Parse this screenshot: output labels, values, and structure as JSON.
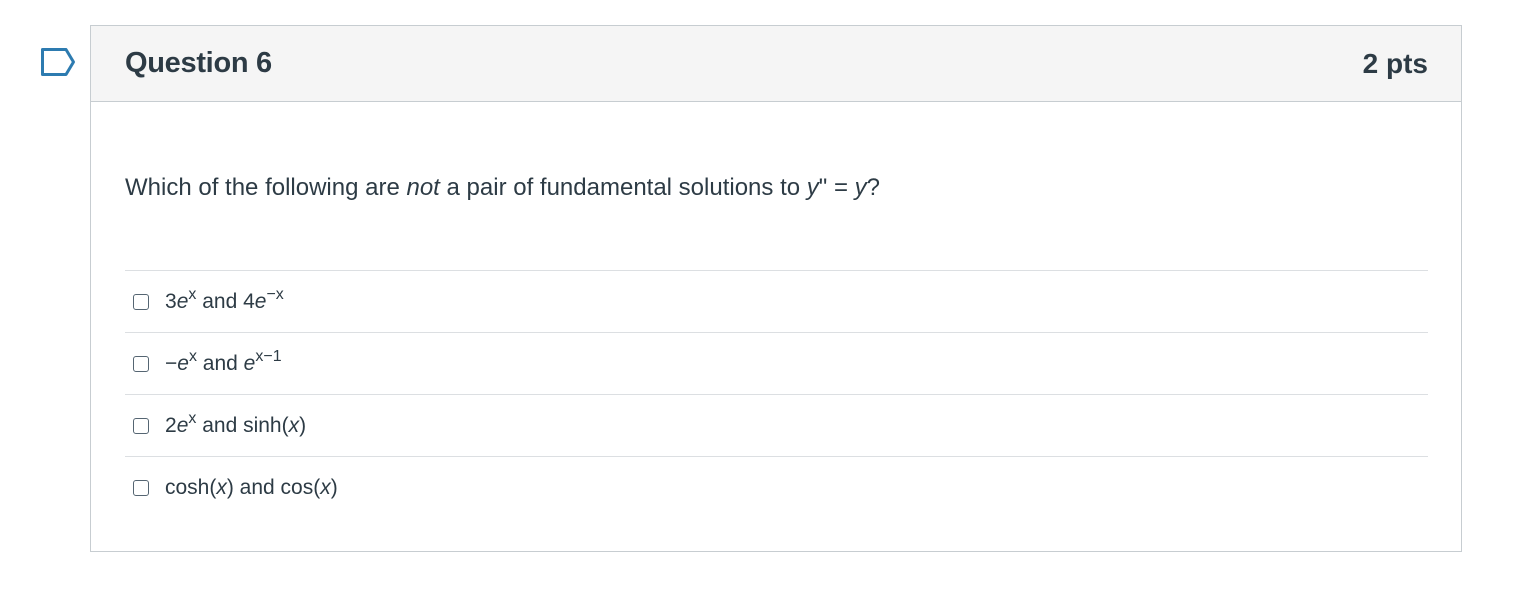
{
  "question": {
    "title": "Question 6",
    "points": "2 pts",
    "text_before": "Which of the following are ",
    "text_emphasis": "not",
    "text_after": " a pair of fundamental solutions to ",
    "equation_lhs": "y",
    "equation_prime": "\"",
    "equation_eq": " = ",
    "equation_rhs": "y",
    "text_end": "?",
    "flag_icon": "bookmark-flag-icon"
  },
  "answers": [
    {
      "checked": false,
      "parts": {
        "a1": "3",
        "a2": "e",
        "a3": "x",
        "a4": " and 4",
        "a5": "e",
        "a6": "−x"
      }
    },
    {
      "checked": false,
      "parts": {
        "a1": "−",
        "a2": "e",
        "a3": "x",
        "a4": " and ",
        "a5": "e",
        "a6": "x−1"
      }
    },
    {
      "checked": false,
      "parts": {
        "a1": "2",
        "a2": "e",
        "a3": "x",
        "a4": " and sinh(",
        "a5": "x",
        "a6": ")"
      }
    },
    {
      "checked": false,
      "parts": {
        "a1": "cosh(",
        "a2": "x",
        "a3": ") and cos(",
        "a4": "x",
        "a5": ")"
      }
    }
  ],
  "colors": {
    "text": "#2d3b45",
    "header_bg": "#f5f5f5",
    "border": "#c7cdd1",
    "flag": "#2d7bb0"
  }
}
